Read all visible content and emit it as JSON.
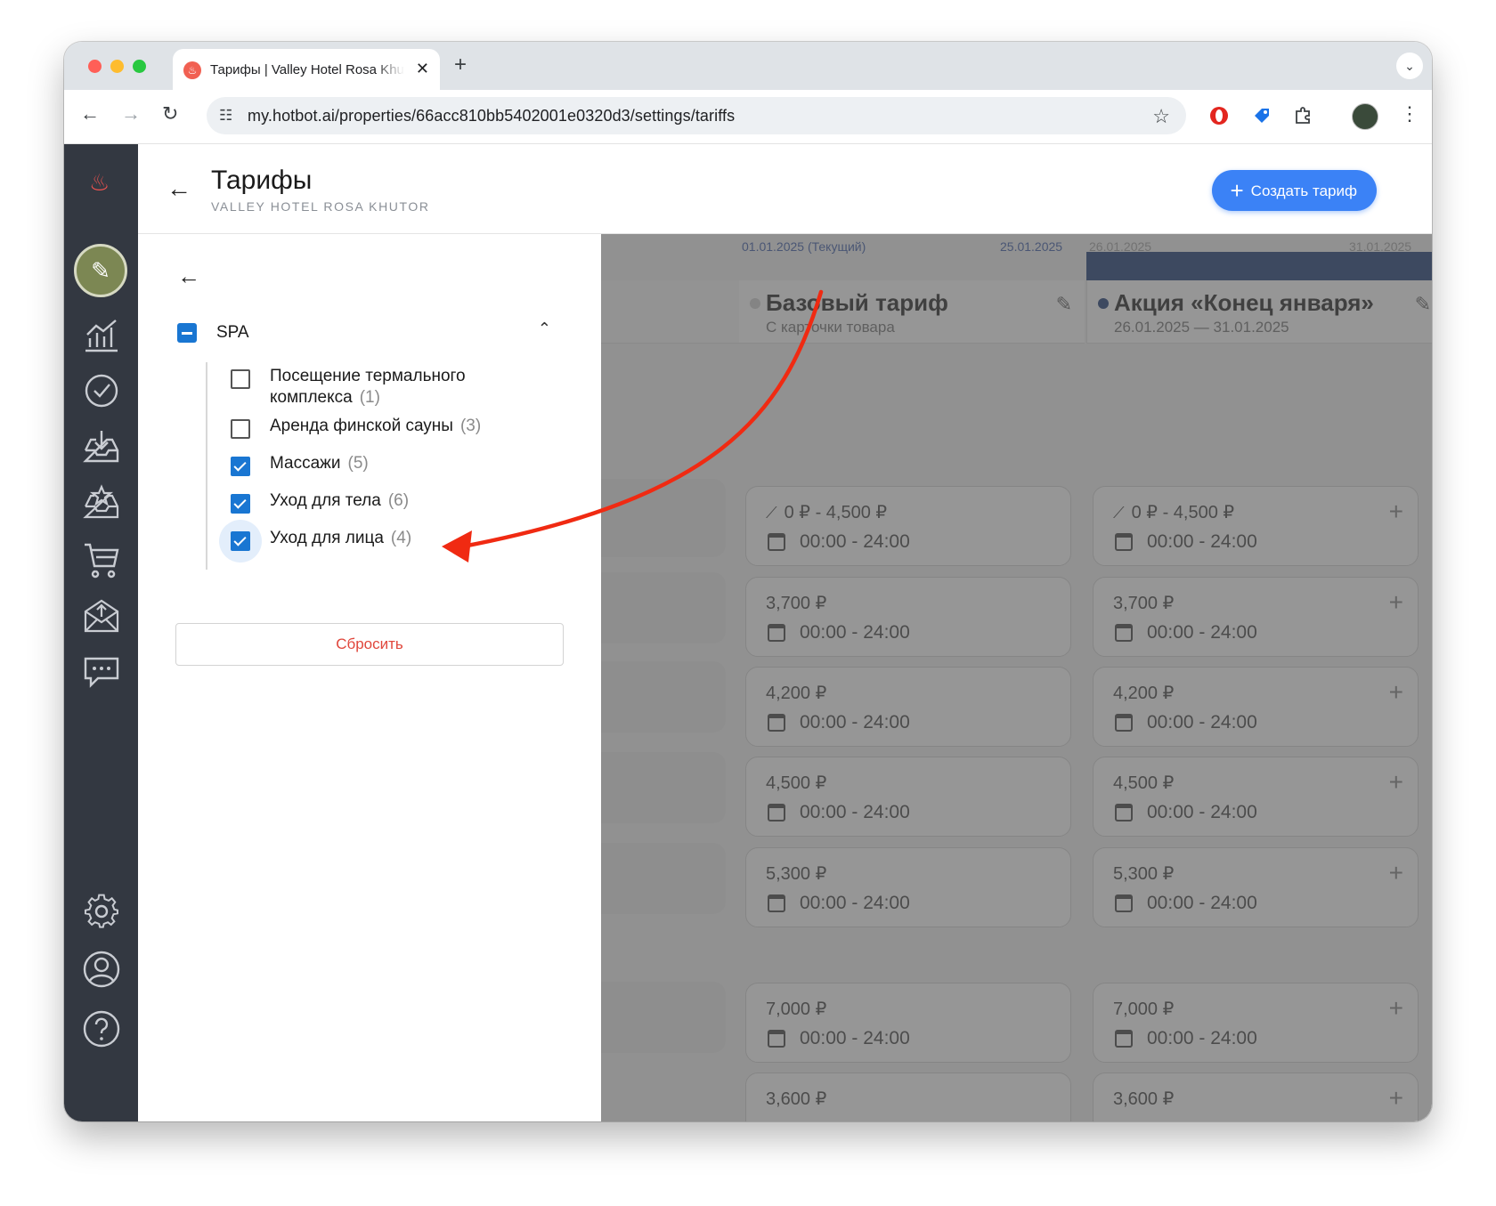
{
  "browser": {
    "tab_title": "Тарифы | Valley Hotel Rosa Khutor",
    "favicon": "flame-icon",
    "url": "my.hotbot.ai/properties/66acc810bb5402001e0320d3/settings/tariffs"
  },
  "header": {
    "title": "Тарифы",
    "subtitle": "VALLEY HOTEL ROSA KHUTOR",
    "create_button": "Создать тариф"
  },
  "filter": {
    "group_label": "SPA",
    "group_state": "partial",
    "options": [
      {
        "label": "Посещение термального комплекса",
        "count": "(1)",
        "checked": false
      },
      {
        "label": "Аренда финской сауны",
        "count": "(3)",
        "checked": false
      },
      {
        "label": "Массажи",
        "count": "(5)",
        "checked": true
      },
      {
        "label": "Уход для тела",
        "count": "(6)",
        "checked": true
      },
      {
        "label": "Уход для лица",
        "count": "(4)",
        "checked": true
      }
    ],
    "reset_button": "Сбросить"
  },
  "timeline": {
    "dates": [
      "01.01.2025 (Текущий)",
      "25.01.2025",
      "26.01.2025",
      "31.01.2025"
    ]
  },
  "tariffs": [
    {
      "name": "Базовый тариф",
      "subtitle": "С карточки товара",
      "dot_color": "#cccccc"
    },
    {
      "name": "Акция «Конец января»",
      "subtitle": "26.01.2025 — 31.01.2025",
      "dot_color": "#0b2a6b"
    }
  ],
  "rows": [
    {
      "price": "0 ₽ - 4,500 ₽",
      "time": "00:00 - 24:00"
    },
    {
      "price": "3,700 ₽",
      "time": "00:00 - 24:00"
    },
    {
      "price": "4,200 ₽",
      "time": "00:00 - 24:00"
    },
    {
      "price": "4,500 ₽",
      "time": "00:00 - 24:00"
    },
    {
      "price": "5,300 ₽",
      "time": "00:00 - 24:00"
    },
    {
      "price": "7,000 ₽",
      "time": "00:00 - 24:00"
    },
    {
      "price": "3,600 ₽",
      "time": ""
    }
  ],
  "colors": {
    "accent": "#3b82f6",
    "checkbox": "#1976d2",
    "reset_text": "#e0463b",
    "sidebar": "#333841",
    "annotation_arrow": "#f02a12"
  }
}
